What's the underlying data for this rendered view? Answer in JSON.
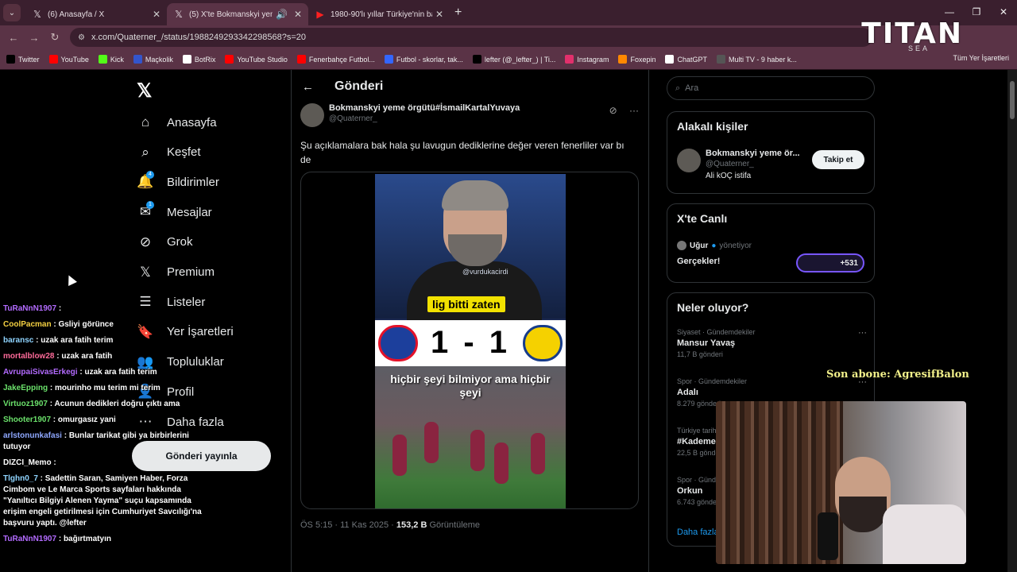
{
  "browser": {
    "tabs": [
      {
        "title": "(6) Anasayfa / X",
        "icon": "x-logo-icon",
        "active": false
      },
      {
        "title": "(5) X'te Bokmanskyi yeme ö",
        "icon": "x-logo-icon",
        "active": true
      },
      {
        "title": "1980-90'lı yıllar Türkiye'nin baş",
        "icon": "youtube-icon",
        "active": false
      }
    ],
    "url": "x.com/Quaterner_/status/1988249293342298568?s=20",
    "bookmarks": [
      {
        "label": "Twitter",
        "color": "#000000"
      },
      {
        "label": "YouTube",
        "color": "#ff0000"
      },
      {
        "label": "Kick",
        "color": "#53fc18"
      },
      {
        "label": "Maçkolik",
        "color": "#3355cc"
      },
      {
        "label": "BotRix",
        "color": "#ffffff"
      },
      {
        "label": "YouTube Studio",
        "color": "#ff0000"
      },
      {
        "label": "Fenerbahçe Futbol...",
        "color": "#ff0000"
      },
      {
        "label": "Futbol - skorlar, tak...",
        "color": "#3366ff"
      },
      {
        "label": "lefter (@_lefter_) | Ti...",
        "color": "#000000"
      },
      {
        "label": "Instagram",
        "color": "#e1306c"
      },
      {
        "label": "Foxepin",
        "color": "#ff8800"
      },
      {
        "label": "ChatGPT",
        "color": "#ffffff"
      },
      {
        "label": "Multi TV - 9 haber k...",
        "color": "#555555"
      }
    ],
    "all_bookmarks": "Tüm Yer İşaretleri"
  },
  "overlay_logo": {
    "text": "TITAN",
    "sub": "SEA"
  },
  "nav": {
    "items": [
      {
        "label": "Anasayfa",
        "icon": "home-icon"
      },
      {
        "label": "Keşfet",
        "icon": "search-icon"
      },
      {
        "label": "Bildirimler",
        "icon": "bell-icon",
        "badge": "4"
      },
      {
        "label": "Mesajlar",
        "icon": "mail-icon",
        "badge": "1"
      },
      {
        "label": "Grok",
        "icon": "grok-icon"
      },
      {
        "label": "Premium",
        "icon": "x-logo-icon"
      },
      {
        "label": "Listeler",
        "icon": "list-icon"
      },
      {
        "label": "Yer İşaretleri",
        "icon": "bookmark-icon"
      },
      {
        "label": "Topluluklar",
        "icon": "people-icon"
      },
      {
        "label": "Profil",
        "icon": "person-icon"
      },
      {
        "label": "Daha fazla",
        "icon": "more-icon"
      }
    ],
    "post_button": "Gönderi yayınla"
  },
  "post": {
    "header": "Gönderi",
    "author_name": "Bokmanskyi yeme örgütü#İsmailKartalYuvaya",
    "author_handle": "@Quaterner_",
    "text": "Şu açıklamalara bak hala şu lavugun dediklerine değer veren fenerliler var bı de",
    "video": {
      "watermark": "@vurdukacirdi",
      "caption_top": "lig bitti zaten",
      "score": "1 - 1",
      "caption_bottom": "hiçbir şeyi bilmiyor ama hiçbir şeyi"
    },
    "time": "ÖS 5:15 · 11 Kas 2025 · ",
    "views_count": "153,2 B",
    "views_label": " Görüntüleme"
  },
  "right": {
    "search_placeholder": "Ara",
    "related": {
      "title": "Alakalı kişiler",
      "name": "Bokmanskyi yeme ör...",
      "handle": "@Quaterner_",
      "bio": "Ali kOÇ istifa",
      "follow": "Takip et"
    },
    "live": {
      "title": "X'te Canlı",
      "host": "Uğur",
      "role": "yönetiyor",
      "topic": "Gerçekler!",
      "count": "+531"
    },
    "trends": {
      "title": "Neler oluyor?",
      "items": [
        {
          "cat": "Siyaset · Gündemdekiler",
          "name": "Mansur Yavaş",
          "count": "11,7 B gönderi"
        },
        {
          "cat": "Spor · Gündemdekiler",
          "name": "Adalı",
          "count": "8.279 gönderi"
        },
        {
          "cat": "Türkiye tarihinde",
          "name": "#Kademe",
          "count": "22,5 B gönderi"
        },
        {
          "cat": "Spor · Gündemdekiler",
          "name": "Orkun",
          "count": "6.743 gönderi"
        }
      ],
      "more": "Daha fazla"
    }
  },
  "stream": {
    "last_sub": "Son abone: AgresifBalon",
    "chat": [
      {
        "user": "TuRaNnN1907",
        "color": "#b36bff",
        "text": ""
      },
      {
        "user": "CoolPacman",
        "color": "#f5d142",
        "text": "Gsliyi görünce"
      },
      {
        "user": "baransc",
        "color": "#8fd4ff",
        "text": "uzak ara fatih terim"
      },
      {
        "user": "mortalblow28",
        "color": "#ff6b9a",
        "text": "uzak ara fatih"
      },
      {
        "user": "AvrupaiSivasErkegi",
        "color": "#b36bff",
        "text": "uzak ara fatih terim"
      },
      {
        "user": "JakeEpping",
        "color": "#6be16b",
        "text": "mourinho mu terim mi terim"
      },
      {
        "user": "Virtuoz1907",
        "color": "#6be16b",
        "text": "Acunun dedikleri doğru çıktı ama"
      },
      {
        "user": "Shooter1907",
        "color": "#6be16b",
        "text": "omurgasız yani"
      },
      {
        "user": "arlstonunkafasi",
        "color": "#8fa8ff",
        "text": "Bunlar tarikat gibi ya birbirlerini tutuyor"
      },
      {
        "user": "DIZCI_Memo",
        "color": "#ffffff",
        "text": ""
      },
      {
        "user": "Tlghn0_7",
        "color": "#8fd4ff",
        "text": "Sadettin Saran, Samiyen Haber, Forza Cimbom ve Le Marca Sports sayfaları hakkında \"Yanıltıcı Bilgiyi Alenen Yayma\" suçu kapsamında erişim engeli getirilmesi için Cumhuriyet Savcılığı'na başvuru yaptı. @lefter"
      },
      {
        "user": "TuRaNnN1907",
        "color": "#b36bff",
        "text": "bağırtmatyın"
      }
    ]
  }
}
